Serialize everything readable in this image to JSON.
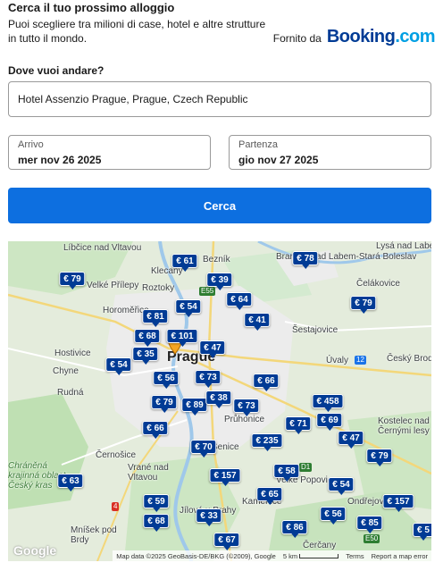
{
  "header": {
    "title": "Cerca il tuo prossimo alloggio",
    "subtitle": "Puoi scegliere tra milioni di case, hotel e altre strutture in tutto il mondo.",
    "powered_label": "Fornito da",
    "brand_main": "Booking",
    "brand_tld": ".com"
  },
  "search": {
    "destination_label": "Dove vuoi andare?",
    "destination_value": "Hotel Assenzio Prague, Prague, Czech Republic",
    "checkin_label": "Arrivo",
    "checkin_value": "mer nov 26 2025",
    "checkout_label": "Partenza",
    "checkout_value": "gio nov 27 2025",
    "button_label": "Cerca"
  },
  "map": {
    "places": [
      "Líbčice nad Vltavou",
      "Klecany",
      "Bezník",
      "Brandýs nad Labem-Stará Boleslav",
      "Lysá nad Labem",
      "Velké Přílepy",
      "Roztoky",
      "Čelákovice",
      "Horoměřice",
      "Šestajovice",
      "Hostivice",
      "Prague",
      "Úvaly",
      "Český Brod",
      "Chyne",
      "Rudná",
      "Průhonice",
      "Kostelec nad Černými lesy",
      "Černošice",
      "Vrané nad Vltavou",
      "Chráněná krajinná oblast Český kras",
      "Jílové u Prahy",
      "Mníšek pod Brdy",
      "Kamenice",
      "Ondřejov",
      "Čerčany",
      "Velké Popovice",
      "Senice"
    ],
    "routes": [
      "E55",
      "12",
      "D1",
      "4",
      "E50"
    ],
    "prices": [
      "€ 61",
      "€ 78",
      "€ 79",
      "€ 39",
      "€ 64",
      "€ 79",
      "€ 81",
      "€ 54",
      "€ 41",
      "€ 68",
      "€ 101",
      "€ 47",
      "€ 35",
      "€ 54",
      "€ 56",
      "€ 73",
      "€ 66",
      "€ 79",
      "€ 89",
      "€ 38",
      "€ 73",
      "€ 458",
      "€ 71",
      "€ 69",
      "€ 66",
      "€ 47",
      "€ 70",
      "€ 235",
      "€ 79",
      "€ 157",
      "€ 58",
      "€ 63",
      "€ 65",
      "€ 54",
      "€ 59",
      "€ 157",
      "€ 33",
      "€ 56",
      "€ 68",
      "€ 85",
      "€ 86",
      "€ 67",
      "€ 5"
    ],
    "attribution": "Map data ©2025 GeoBasis-DE/BKG (©2009), Google",
    "scale_label": "5 km",
    "terms_label": "Terms",
    "report_label": "Report a map error",
    "google_label": "Google"
  },
  "colors": {
    "brand_blue": "#003b95",
    "button_blue": "#0d6fe0",
    "map_green": "#c8e6c0",
    "map_urban": "#e8e8e8"
  }
}
